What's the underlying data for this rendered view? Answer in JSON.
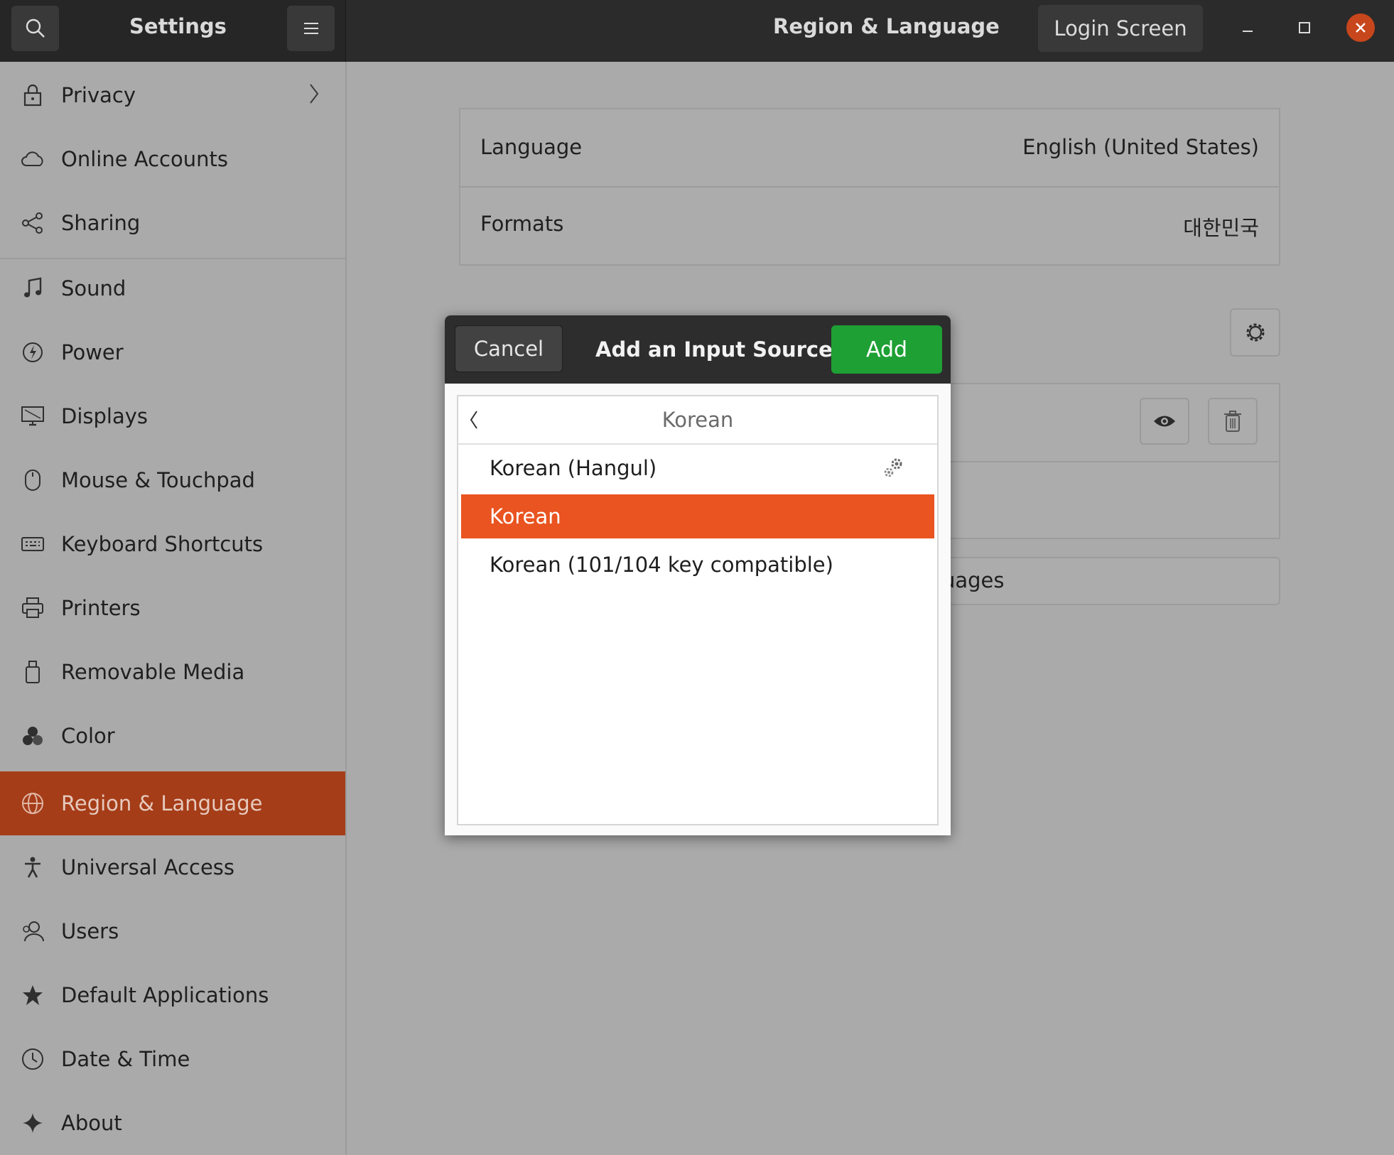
{
  "titlebar": {
    "app_title": "Settings",
    "page_title": "Region & Language",
    "login_screen_label": "Login Screen"
  },
  "sidebar": {
    "items": [
      {
        "label": "Privacy"
      },
      {
        "label": "Online Accounts"
      },
      {
        "label": "Sharing"
      },
      {
        "label": "Sound"
      },
      {
        "label": "Power"
      },
      {
        "label": "Displays"
      },
      {
        "label": "Mouse & Touchpad"
      },
      {
        "label": "Keyboard Shortcuts"
      },
      {
        "label": "Printers"
      },
      {
        "label": "Removable Media"
      },
      {
        "label": "Color"
      },
      {
        "label": "Region & Language"
      },
      {
        "label": "Universal Access"
      },
      {
        "label": "Users"
      },
      {
        "label": "Default Applications"
      },
      {
        "label": "Date & Time"
      },
      {
        "label": "About"
      }
    ],
    "active_item": "Region & Language"
  },
  "main": {
    "language_label": "Language",
    "language_value": "English (United States)",
    "formats_label": "Formats",
    "formats_value": "대한민국",
    "manage_languages_fragment": "uages"
  },
  "dialog": {
    "cancel_label": "Cancel",
    "title": "Add an Input Source",
    "add_label": "Add",
    "list_header": "Korean",
    "options": [
      {
        "label": "Korean (Hangul)",
        "has_settings": true
      },
      {
        "label": "Korean",
        "selected": true
      },
      {
        "label": "Korean (101/104 key compatible)"
      }
    ]
  },
  "colors": {
    "accent": "#e95420",
    "sidebar_active": "#a53d18",
    "add_button": "#1ea034",
    "titlebar": "#2b2b2b",
    "close_button": "#c8461c"
  }
}
